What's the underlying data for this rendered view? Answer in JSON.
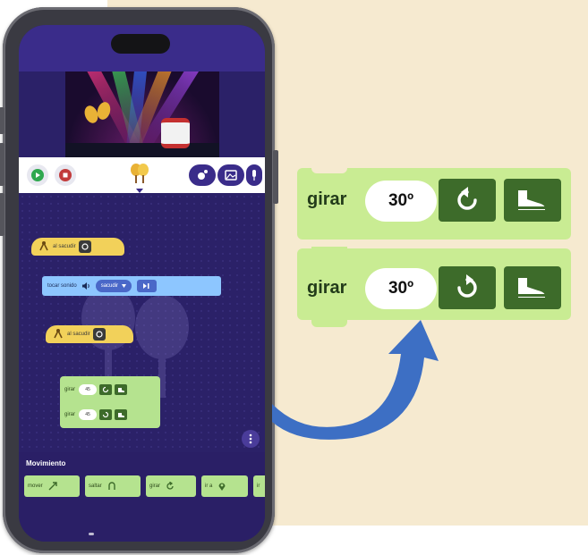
{
  "app": {
    "workspace": {
      "hat_block_1_label": "al sacudir",
      "sound_block_label": "tocar sonido",
      "sound_select_value": "sacudir",
      "hat_block_2_label": "al sacudir",
      "turn_block_1": {
        "label": "girar",
        "value": "45"
      },
      "turn_block_2": {
        "label": "girar",
        "value": "45"
      }
    },
    "palette": {
      "title": "Movimiento",
      "blocks": [
        {
          "label": "mover",
          "icon": "diagonal-arrow-icon"
        },
        {
          "label": "saltar",
          "icon": "jump-arch-icon"
        },
        {
          "label": "girar",
          "icon": "rotate-icon"
        },
        {
          "label": "ir a",
          "icon": "location-pin-icon"
        },
        {
          "label": "ir",
          "icon": "more-icon"
        }
      ]
    }
  },
  "callout": {
    "block_1": {
      "label": "girar",
      "value": "30º",
      "direction_icon": "rotate-counterclockwise-icon",
      "sprite_icon": "shoe-icon"
    },
    "block_2": {
      "label": "girar",
      "value": "30º",
      "direction_icon": "rotate-clockwise-icon",
      "sprite_icon": "shoe-icon"
    }
  },
  "colors": {
    "background": "#f6ead0",
    "block_green": "#c9ec93",
    "block_dark_green": "#3d6b2a",
    "arrow_blue": "#3d6fc4",
    "app_purple": "#2b2168"
  }
}
